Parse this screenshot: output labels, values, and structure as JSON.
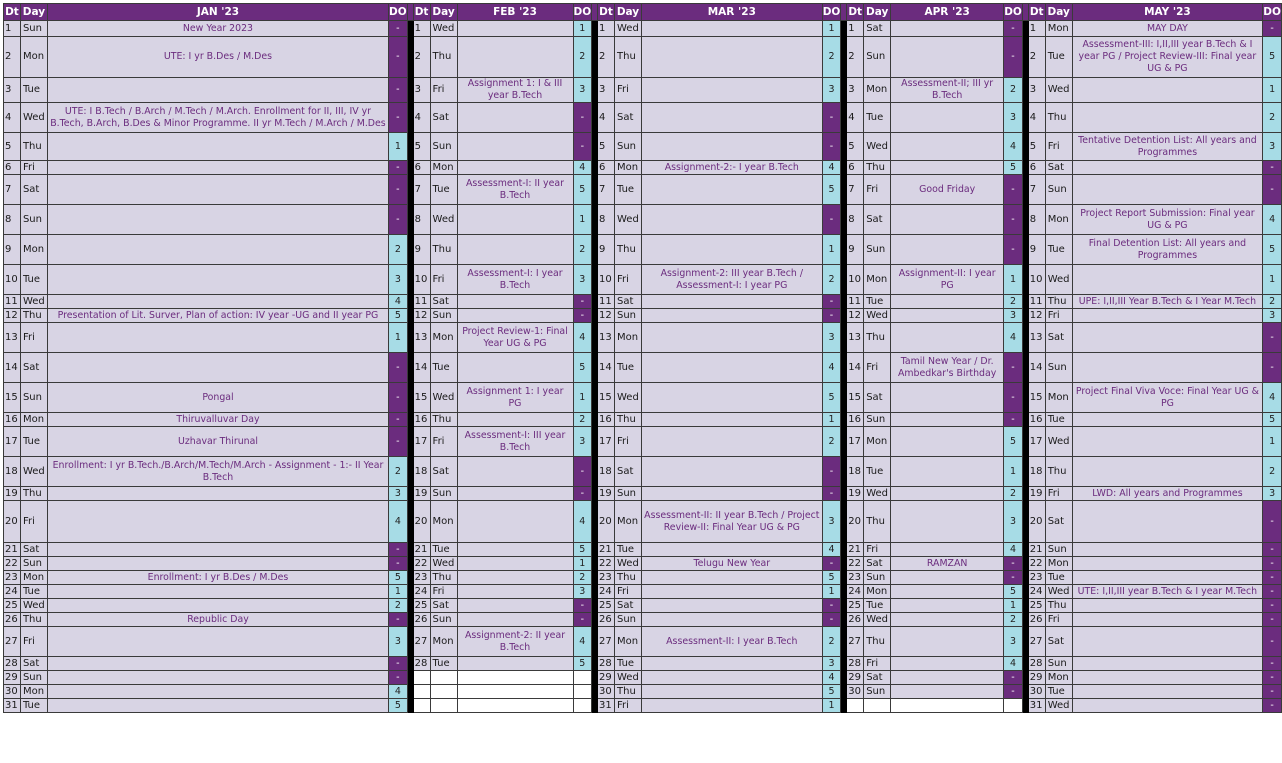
{
  "header": {
    "dt": "Dt",
    "day": "Day",
    "do": "DO"
  },
  "months": [
    {
      "name": "JAN '23",
      "rows": [
        [
          "1",
          "Sun",
          "New Year 2023",
          "-"
        ],
        [
          "2",
          "Mon",
          "UTE: I yr B.Des / M.Des",
          "-"
        ],
        [
          "3",
          "Tue",
          "",
          "-"
        ],
        [
          "4",
          "Wed",
          "UTE: I B.Tech / B.Arch / M.Tech / M.Arch. Enrollment for II, III, IV yr B.Tech, B.Arch, B.Des & Minor Programme. II yr M.Tech / M.Arch / M.Des",
          "-"
        ],
        [
          "5",
          "Thu",
          "",
          "1"
        ],
        [
          "6",
          "Fri",
          "",
          "-"
        ],
        [
          "7",
          "Sat",
          "",
          "-"
        ],
        [
          "8",
          "Sun",
          "",
          "-"
        ],
        [
          "9",
          "Mon",
          "",
          "2"
        ],
        [
          "10",
          "Tue",
          "",
          "3"
        ],
        [
          "11",
          "Wed",
          "",
          "4"
        ],
        [
          "12",
          "Thu",
          "Presentation of Lit. Surver, Plan of action: IV year -UG and II year PG",
          "5"
        ],
        [
          "13",
          "Fri",
          "",
          "1"
        ],
        [
          "14",
          "Sat",
          "",
          "-"
        ],
        [
          "15",
          "Sun",
          "Pongal",
          "-"
        ],
        [
          "16",
          "Mon",
          "Thiruvalluvar Day",
          "-"
        ],
        [
          "17",
          "Tue",
          "Uzhavar Thirunal",
          "-"
        ],
        [
          "18",
          "Wed",
          "Enrollment: I yr B.Tech./B.Arch/M.Tech/M.Arch - Assignment - 1:- II Year B.Tech",
          "2"
        ],
        [
          "19",
          "Thu",
          "",
          "3"
        ],
        [
          "20",
          "Fri",
          "",
          "4"
        ],
        [
          "21",
          "Sat",
          "",
          "-"
        ],
        [
          "22",
          "Sun",
          "",
          "-"
        ],
        [
          "23",
          "Mon",
          "Enrollment: I yr B.Des / M.Des",
          "5"
        ],
        [
          "24",
          "Tue",
          "",
          "1"
        ],
        [
          "25",
          "Wed",
          "",
          "2"
        ],
        [
          "26",
          "Thu",
          "Republic Day",
          "-"
        ],
        [
          "27",
          "Fri",
          "",
          "3"
        ],
        [
          "28",
          "Sat",
          "",
          "-"
        ],
        [
          "29",
          "Sun",
          "",
          "-"
        ],
        [
          "30",
          "Mon",
          "",
          "4"
        ],
        [
          "31",
          "Tue",
          "",
          "5"
        ]
      ]
    },
    {
      "name": "FEB '23",
      "rows": [
        [
          "1",
          "Wed",
          "",
          "1"
        ],
        [
          "2",
          "Thu",
          "",
          "2"
        ],
        [
          "3",
          "Fri",
          "Assignment 1: I & III year B.Tech",
          "3"
        ],
        [
          "4",
          "Sat",
          "",
          "-"
        ],
        [
          "5",
          "Sun",
          "",
          "-"
        ],
        [
          "6",
          "Mon",
          "",
          "4"
        ],
        [
          "7",
          "Tue",
          "Assessment-I: II year B.Tech",
          "5"
        ],
        [
          "8",
          "Wed",
          "",
          "1"
        ],
        [
          "9",
          "Thu",
          "",
          "2"
        ],
        [
          "10",
          "Fri",
          "Assessment-I: I year B.Tech",
          "3"
        ],
        [
          "11",
          "Sat",
          "",
          "-"
        ],
        [
          "12",
          "Sun",
          "",
          "-"
        ],
        [
          "13",
          "Mon",
          "Project Review-1: Final Year UG & PG",
          "4"
        ],
        [
          "14",
          "Tue",
          "",
          "5"
        ],
        [
          "15",
          "Wed",
          "Assignment 1: I year PG",
          "1"
        ],
        [
          "16",
          "Thu",
          "",
          "2"
        ],
        [
          "17",
          "Fri",
          "Assessment-I: III year B.Tech",
          "3"
        ],
        [
          "18",
          "Sat",
          "",
          "-"
        ],
        [
          "19",
          "Sun",
          "",
          "-"
        ],
        [
          "20",
          "Mon",
          "",
          "4"
        ],
        [
          "21",
          "Tue",
          "",
          "5"
        ],
        [
          "22",
          "Wed",
          "",
          "1"
        ],
        [
          "23",
          "Thu",
          "",
          "2"
        ],
        [
          "24",
          "Fri",
          "",
          "3"
        ],
        [
          "25",
          "Sat",
          "",
          "-"
        ],
        [
          "26",
          "Sun",
          "",
          "-"
        ],
        [
          "27",
          "Mon",
          "Assignment-2: II year B.Tech",
          "4"
        ],
        [
          "28",
          "Tue",
          "",
          "5"
        ],
        [
          "",
          "",
          "",
          ""
        ],
        [
          "",
          "",
          "",
          ""
        ],
        [
          "",
          "",
          "",
          ""
        ]
      ]
    },
    {
      "name": "MAR '23",
      "rows": [
        [
          "1",
          "Wed",
          "",
          "1"
        ],
        [
          "2",
          "Thu",
          "",
          "2"
        ],
        [
          "3",
          "Fri",
          "",
          "3"
        ],
        [
          "4",
          "Sat",
          "",
          "-"
        ],
        [
          "5",
          "Sun",
          "",
          "-"
        ],
        [
          "6",
          "Mon",
          "Assignment-2:- I year B.Tech",
          "4"
        ],
        [
          "7",
          "Tue",
          "",
          "5"
        ],
        [
          "8",
          "Wed",
          "",
          "-"
        ],
        [
          "9",
          "Thu",
          "",
          "1"
        ],
        [
          "10",
          "Fri",
          "Assignment-2: III year B.Tech / Assessment-I: I year PG",
          "2"
        ],
        [
          "11",
          "Sat",
          "",
          "-"
        ],
        [
          "12",
          "Sun",
          "",
          "-"
        ],
        [
          "13",
          "Mon",
          "",
          "3"
        ],
        [
          "14",
          "Tue",
          "",
          "4"
        ],
        [
          "15",
          "Wed",
          "",
          "5"
        ],
        [
          "16",
          "Thu",
          "",
          "1"
        ],
        [
          "17",
          "Fri",
          "",
          "2"
        ],
        [
          "18",
          "Sat",
          "",
          "-"
        ],
        [
          "19",
          "Sun",
          "",
          "-"
        ],
        [
          "20",
          "Mon",
          "Assessment-II: II year B.Tech / Project Review-II: Final Year UG & PG",
          "3"
        ],
        [
          "21",
          "Tue",
          "",
          "4"
        ],
        [
          "22",
          "Wed",
          "Telugu New Year",
          "-"
        ],
        [
          "23",
          "Thu",
          "",
          "5"
        ],
        [
          "24",
          "Fri",
          "",
          "1"
        ],
        [
          "25",
          "Sat",
          "",
          "-"
        ],
        [
          "26",
          "Sun",
          "",
          "-"
        ],
        [
          "27",
          "Mon",
          "Assessment-II: I year B.Tech",
          "2"
        ],
        [
          "28",
          "Tue",
          "",
          "3"
        ],
        [
          "29",
          "Wed",
          "",
          "4"
        ],
        [
          "30",
          "Thu",
          "",
          "5"
        ],
        [
          "31",
          "Fri",
          "",
          "1"
        ]
      ]
    },
    {
      "name": "APR '23",
      "rows": [
        [
          "1",
          "Sat",
          "",
          "-"
        ],
        [
          "2",
          "Sun",
          "",
          "-"
        ],
        [
          "3",
          "Mon",
          "Assessment-II; III yr B.Tech",
          "2"
        ],
        [
          "4",
          "Tue",
          "",
          "3"
        ],
        [
          "5",
          "Wed",
          "",
          "4"
        ],
        [
          "6",
          "Thu",
          "",
          "5"
        ],
        [
          "7",
          "Fri",
          "Good Friday",
          "-"
        ],
        [
          "8",
          "Sat",
          "",
          "-"
        ],
        [
          "9",
          "Sun",
          "",
          "-"
        ],
        [
          "10",
          "Mon",
          "Assignment-II: I year PG",
          "1"
        ],
        [
          "11",
          "Tue",
          "",
          "2"
        ],
        [
          "12",
          "Wed",
          "",
          "3"
        ],
        [
          "13",
          "Thu",
          "",
          "4"
        ],
        [
          "14",
          "Fri",
          "Tamil New Year / Dr. Ambedkar's Birthday",
          "-"
        ],
        [
          "15",
          "Sat",
          "",
          "-"
        ],
        [
          "16",
          "Sun",
          "",
          "-"
        ],
        [
          "17",
          "Mon",
          "",
          "5"
        ],
        [
          "18",
          "Tue",
          "",
          "1"
        ],
        [
          "19",
          "Wed",
          "",
          "2"
        ],
        [
          "20",
          "Thu",
          "",
          "3"
        ],
        [
          "21",
          "Fri",
          "",
          "4"
        ],
        [
          "22",
          "Sat",
          "RAMZAN",
          "-"
        ],
        [
          "23",
          "Sun",
          "",
          "-"
        ],
        [
          "24",
          "Mon",
          "",
          "5"
        ],
        [
          "25",
          "Tue",
          "",
          "1"
        ],
        [
          "26",
          "Wed",
          "",
          "2"
        ],
        [
          "27",
          "Thu",
          "",
          "3"
        ],
        [
          "28",
          "Fri",
          "",
          "4"
        ],
        [
          "29",
          "Sat",
          "",
          "-"
        ],
        [
          "30",
          "Sun",
          "",
          "-"
        ],
        [
          "",
          "",
          "",
          ""
        ]
      ]
    },
    {
      "name": "MAY '23",
      "rows": [
        [
          "1",
          "Mon",
          "MAY DAY",
          "-"
        ],
        [
          "2",
          "Tue",
          "Assessment-III: I,II,III year B.Tech & I year PG / Project Review-III: Final year UG & PG",
          "5"
        ],
        [
          "3",
          "Wed",
          "",
          "1"
        ],
        [
          "4",
          "Thu",
          "",
          "2"
        ],
        [
          "5",
          "Fri",
          "Tentative Detention List: All years and Programmes",
          "3"
        ],
        [
          "6",
          "Sat",
          "",
          "-"
        ],
        [
          "7",
          "Sun",
          "",
          "-"
        ],
        [
          "8",
          "Mon",
          "Project Report Submission: Final year UG & PG",
          "4"
        ],
        [
          "9",
          "Tue",
          "Final Detention List: All years and Programmes",
          "5"
        ],
        [
          "10",
          "Wed",
          "",
          "1"
        ],
        [
          "11",
          "Thu",
          "UPE: I,II,III Year B.Tech & I Year M.Tech",
          "2"
        ],
        [
          "12",
          "Fri",
          "",
          "3"
        ],
        [
          "13",
          "Sat",
          "",
          "-"
        ],
        [
          "14",
          "Sun",
          "",
          "-"
        ],
        [
          "15",
          "Mon",
          "Project Final Viva Voce: Final Year UG & PG",
          "4"
        ],
        [
          "16",
          "Tue",
          "",
          "5"
        ],
        [
          "17",
          "Wed",
          "",
          "1"
        ],
        [
          "18",
          "Thu",
          "",
          "2"
        ],
        [
          "19",
          "Fri",
          "LWD: All years and Programmes",
          "3"
        ],
        [
          "20",
          "Sat",
          "",
          "-"
        ],
        [
          "21",
          "Sun",
          "",
          "-"
        ],
        [
          "22",
          "Mon",
          "",
          "-"
        ],
        [
          "23",
          "Tue",
          "",
          "-"
        ],
        [
          "24",
          "Wed",
          "UTE: I,II,III year B.Tech & I year M.Tech",
          "-"
        ],
        [
          "25",
          "Thu",
          "",
          "-"
        ],
        [
          "26",
          "Fri",
          "",
          "-"
        ],
        [
          "27",
          "Sat",
          "",
          "-"
        ],
        [
          "28",
          "Sun",
          "",
          "-"
        ],
        [
          "29",
          "Mon",
          "",
          "-"
        ],
        [
          "30",
          "Tue",
          "",
          "-"
        ],
        [
          "31",
          "Wed",
          "",
          "-"
        ]
      ]
    }
  ],
  "colors": {
    "header_bg": "#6b2c7e",
    "cell_bg": "#d8d4e4",
    "working_do_bg": "#a7dce6",
    "event_text": "#6b2c7e"
  }
}
